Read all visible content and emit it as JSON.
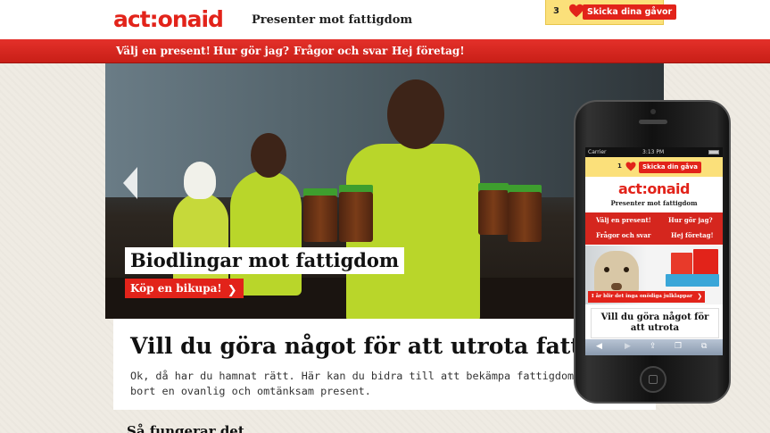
{
  "header": {
    "logo": "act:onaid",
    "tagline": "Presenter mot fattigdom"
  },
  "cart": {
    "count": "3",
    "button_label": "Skicka dina gåvor",
    "icon": "heart-icon",
    "bg_color": "#fbe07a"
  },
  "nav": {
    "items": [
      {
        "label": "Välj en present!"
      },
      {
        "label": "Hur gör jag?"
      },
      {
        "label": "Frågor och svar"
      },
      {
        "label": "Hej företag!"
      }
    ]
  },
  "hero": {
    "title": "Biodlingar mot fattigdom",
    "button_label": "Köp en bikupa!",
    "prev_icon": "chevron-left-icon"
  },
  "main": {
    "headline": "Vill du göra något för att utrota fattigdom?",
    "intro": "Ok, då har du hamnat rätt. Här kan du bidra till att bekämpa fattigdom genom att ge bort en ovanlig och omtänksam present.",
    "how_title": "Så fungerar det"
  },
  "phone": {
    "status": {
      "carrier": "Carrier",
      "time": "3:13 PM"
    },
    "cart": {
      "count": "1",
      "button_label": "Skicka din gåva"
    },
    "logo": "act:onaid",
    "tagline": "Presenter mot fattigdom",
    "nav": [
      {
        "label": "Välj en present!"
      },
      {
        "label": "Hur gör jag?"
      },
      {
        "label": "Frågor och svar"
      },
      {
        "label": "Hej företag!"
      }
    ],
    "banner_caption": "I år blir det inga onödiga julklappar",
    "headline": "Vill du göra något för att utrota",
    "toolbar_icons": [
      "back-icon",
      "forward-icon",
      "share-icon",
      "bookmarks-icon",
      "tabs-icon"
    ]
  },
  "colors": {
    "brand_red": "#e2231a",
    "nav_red": "#c81f17",
    "yellow": "#fbe07a",
    "background": "#efebe3"
  }
}
